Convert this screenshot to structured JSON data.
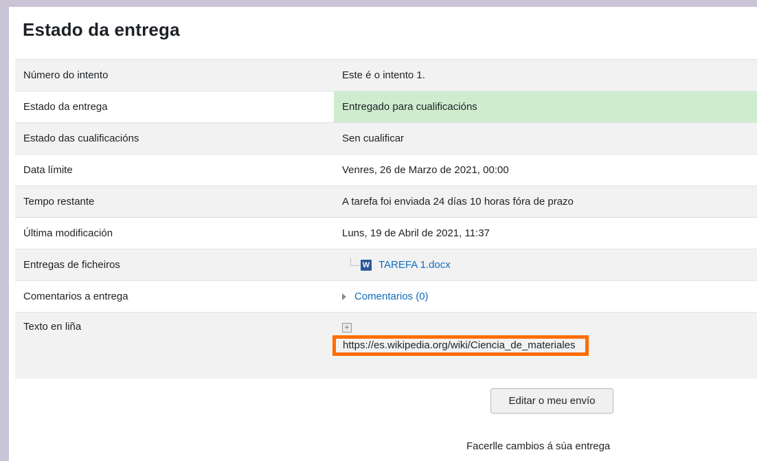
{
  "section_title": "Estado da entrega",
  "rows": [
    {
      "label": "Número do intento",
      "value": "Este é o intento 1."
    },
    {
      "label": "Estado da entrega",
      "value": "Entregado para cualificacións"
    },
    {
      "label": "Estado das cualificacións",
      "value": "Sen cualificar"
    },
    {
      "label": "Data límite",
      "value": "Venres, 26 de Marzo de 2021, 00:00"
    },
    {
      "label": "Tempo restante",
      "value": "A tarefa foi enviada 24 días 10 horas fóra de prazo"
    },
    {
      "label": "Última modificación",
      "value": "Luns, 19 de Abril de 2021, 11:37"
    },
    {
      "label": "Entregas de ficheiros",
      "file_name": "TAREFA 1.docx",
      "file_icon": "word-document-icon"
    },
    {
      "label": "Comentarios a entrega",
      "comments_link": "Comentarios (0)"
    },
    {
      "label": "Texto en liña",
      "online_text": "https://es.wikipedia.org/wiki/Ciencia_de_materiales"
    }
  ],
  "colors": {
    "submitted_highlight": "#cfeccf",
    "annotation_box": "#ff6d00",
    "link": "#0f6cbf"
  },
  "edit_button_label": "Editar o meu envío",
  "edit_hint": "Facerlle cambios á súa entrega"
}
